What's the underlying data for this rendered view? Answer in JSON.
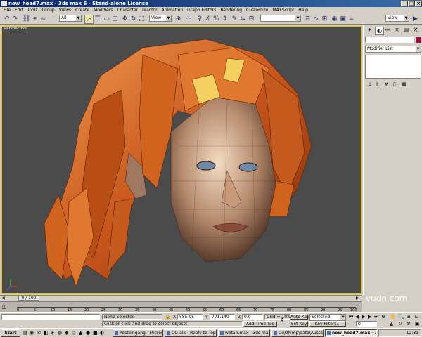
{
  "window": {
    "title": "new_head7.max - 3ds max 6 - Stand-alone License"
  },
  "menu": [
    "File",
    "Edit",
    "Tools",
    "Group",
    "Views",
    "Create",
    "Modifiers",
    "Character",
    "reactor",
    "Animation",
    "Graph Editors",
    "Rendering",
    "Customize",
    "MAXScript",
    "Help"
  ],
  "toolbar": {
    "selection_filter": "All",
    "ref_coord": "View",
    "named_selection": "",
    "right_view": "View"
  },
  "viewport": {
    "label": "Perspective"
  },
  "command_panel": {
    "object_name": "",
    "modifier_list": "Modifier List"
  },
  "timeline": {
    "frame_readout": "0 / 100",
    "ticks": [
      "0",
      "5",
      "10",
      "15",
      "20",
      "25",
      "30",
      "35",
      "40",
      "45",
      "50",
      "55",
      "60",
      "65",
      "70",
      "75",
      "80",
      "85",
      "90",
      "95",
      "100"
    ]
  },
  "status": {
    "selection": "None Selected",
    "prompt": "Click or click-and-drag to select objects",
    "x_label": "X",
    "x_value": "585.05",
    "y_label": "Y",
    "y_value": "771.149",
    "z_label": "Z",
    "z_value": "0.0",
    "grid": "Grid = 10.0",
    "add_time_tag": "Add Time Tag",
    "auto_key": "Auto Key",
    "auto_key_select": "Selected",
    "set_key": "Set Key",
    "key_filters": "Key Filters...",
    "current_frame": "0"
  },
  "taskbar": {
    "start": "Start",
    "tasks": [
      "Posteingang - Microsoft ...",
      "CGTalk - Reply to Topic - ...",
      "wotan.max - 3ds max 6 - ...",
      "D:\\Olymp\\data\\Austausch...",
      "new_head7.max - 3ds..."
    ],
    "clock": "12:31"
  },
  "watermark": "vudn.com",
  "colors": {
    "title_bar": "#0a246a",
    "viewport_bg": "#4b4b4b",
    "active_border": "#f0c000",
    "hair": "#d2691e",
    "skin": "#c89a7a"
  }
}
